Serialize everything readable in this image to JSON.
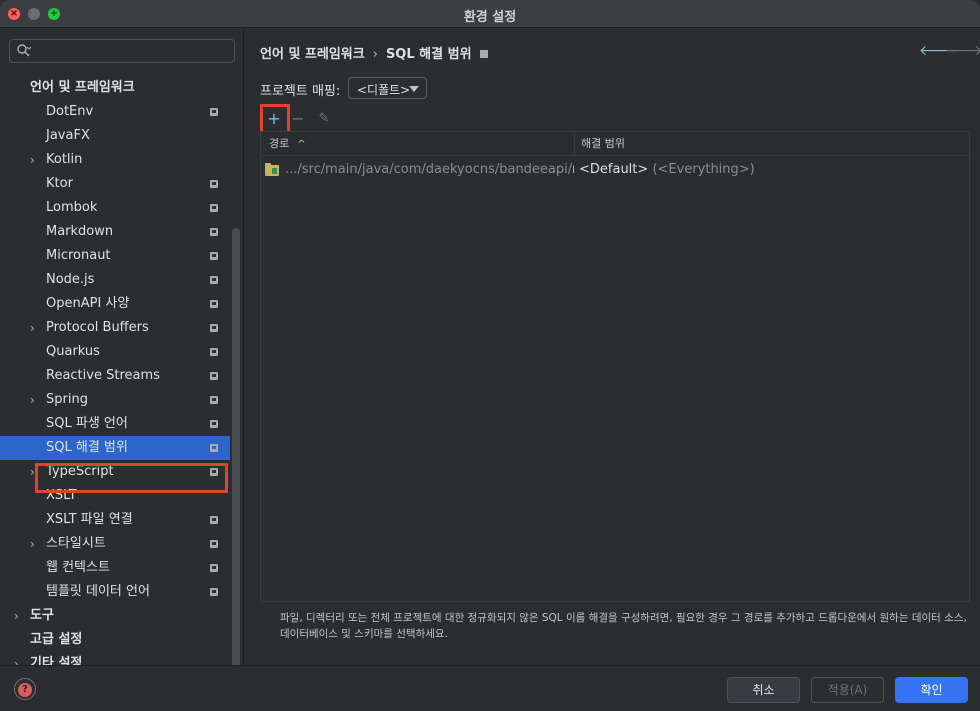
{
  "window": {
    "title": "환경 설정"
  },
  "sidebar": {
    "search": {
      "value": "",
      "placeholder": ""
    },
    "items": [
      {
        "label": "언어 및 프레임워크",
        "level": 0,
        "bold": true
      },
      {
        "label": "DotEnv",
        "level": 1,
        "badge": true
      },
      {
        "label": "JavaFX",
        "level": 1
      },
      {
        "label": "Kotlin",
        "level": 1,
        "expandable": true
      },
      {
        "label": "Ktor",
        "level": 1,
        "badge": true
      },
      {
        "label": "Lombok",
        "level": 1,
        "badge": true
      },
      {
        "label": "Markdown",
        "level": 1,
        "badge": true
      },
      {
        "label": "Micronaut",
        "level": 1,
        "badge": true
      },
      {
        "label": "Node.js",
        "level": 1,
        "badge": true
      },
      {
        "label": "OpenAPI 사양",
        "level": 1,
        "badge": true
      },
      {
        "label": "Protocol Buffers",
        "level": 1,
        "expandable": true,
        "badge": true
      },
      {
        "label": "Quarkus",
        "level": 1,
        "badge": true
      },
      {
        "label": "Reactive Streams",
        "level": 1,
        "badge": true
      },
      {
        "label": "Spring",
        "level": 1,
        "expandable": true,
        "badge": true
      },
      {
        "label": "SQL 파생 언어",
        "level": 1,
        "badge": true
      },
      {
        "label": "SQL 해결 범위",
        "level": 1,
        "badge": true,
        "selected": true
      },
      {
        "label": "TypeScript",
        "level": 1,
        "expandable": true,
        "badge": true
      },
      {
        "label": "XSLT",
        "level": 1
      },
      {
        "label": "XSLT 파일 연결",
        "level": 1,
        "badge": true
      },
      {
        "label": "스타일시트",
        "level": 1,
        "expandable": true,
        "badge": true
      },
      {
        "label": "웹 컨텍스트",
        "level": 1,
        "badge": true
      },
      {
        "label": "템플릿 데이터 언어",
        "level": 1,
        "badge": true
      },
      {
        "label": "도구",
        "level": 0,
        "bold": true,
        "expandable": true
      },
      {
        "label": "고급 설정",
        "level": 0,
        "bold": true
      },
      {
        "label": "기타 설정",
        "level": 0,
        "bold": true,
        "expandable": true
      }
    ]
  },
  "content": {
    "breadcrumb": {
      "parent": "언어 및 프레임워크",
      "separator": "›",
      "current": "SQL 해결 범위"
    },
    "mapping": {
      "label": "프로젝트 매핑:",
      "selected": "<디폴트>"
    },
    "toolbar": {
      "add": "+",
      "remove": "−",
      "edit": "✎"
    },
    "table": {
      "columns": {
        "path": "경로",
        "scope": "해결 범위",
        "sort_indicator": "^"
      },
      "rows": [
        {
          "path_prefix": ".../src/main/java/com/daekyocns/bandeeapi/",
          "path_tail": "map",
          "scope_main": "<Default>",
          "scope_extra": "(<Everything>)"
        }
      ]
    },
    "help_text": "파일, 디렉터리 또는 전체 프로젝트에 대한 정규화되지 않은 SQL 이름 해결을 구성하려면, 필요한 경우 그 경로를 추가하고 드롭다운에서 원하는 데이터 소스, 데이터베이스 및 스키마를 선택하세요."
  },
  "footer": {
    "cancel": "취소",
    "apply": "적용(A)",
    "ok": "확인"
  },
  "colors": {
    "accent": "#3574f0",
    "selection": "#2e65ca",
    "highlight_box": "#e0422e"
  },
  "icons": {
    "back": "arrow-left-icon",
    "forward": "arrow-right-icon",
    "search": "search-icon",
    "help": "help-icon",
    "folder": "folder-icon",
    "add": "plus-icon",
    "remove": "minus-icon",
    "edit": "pencil-icon"
  }
}
